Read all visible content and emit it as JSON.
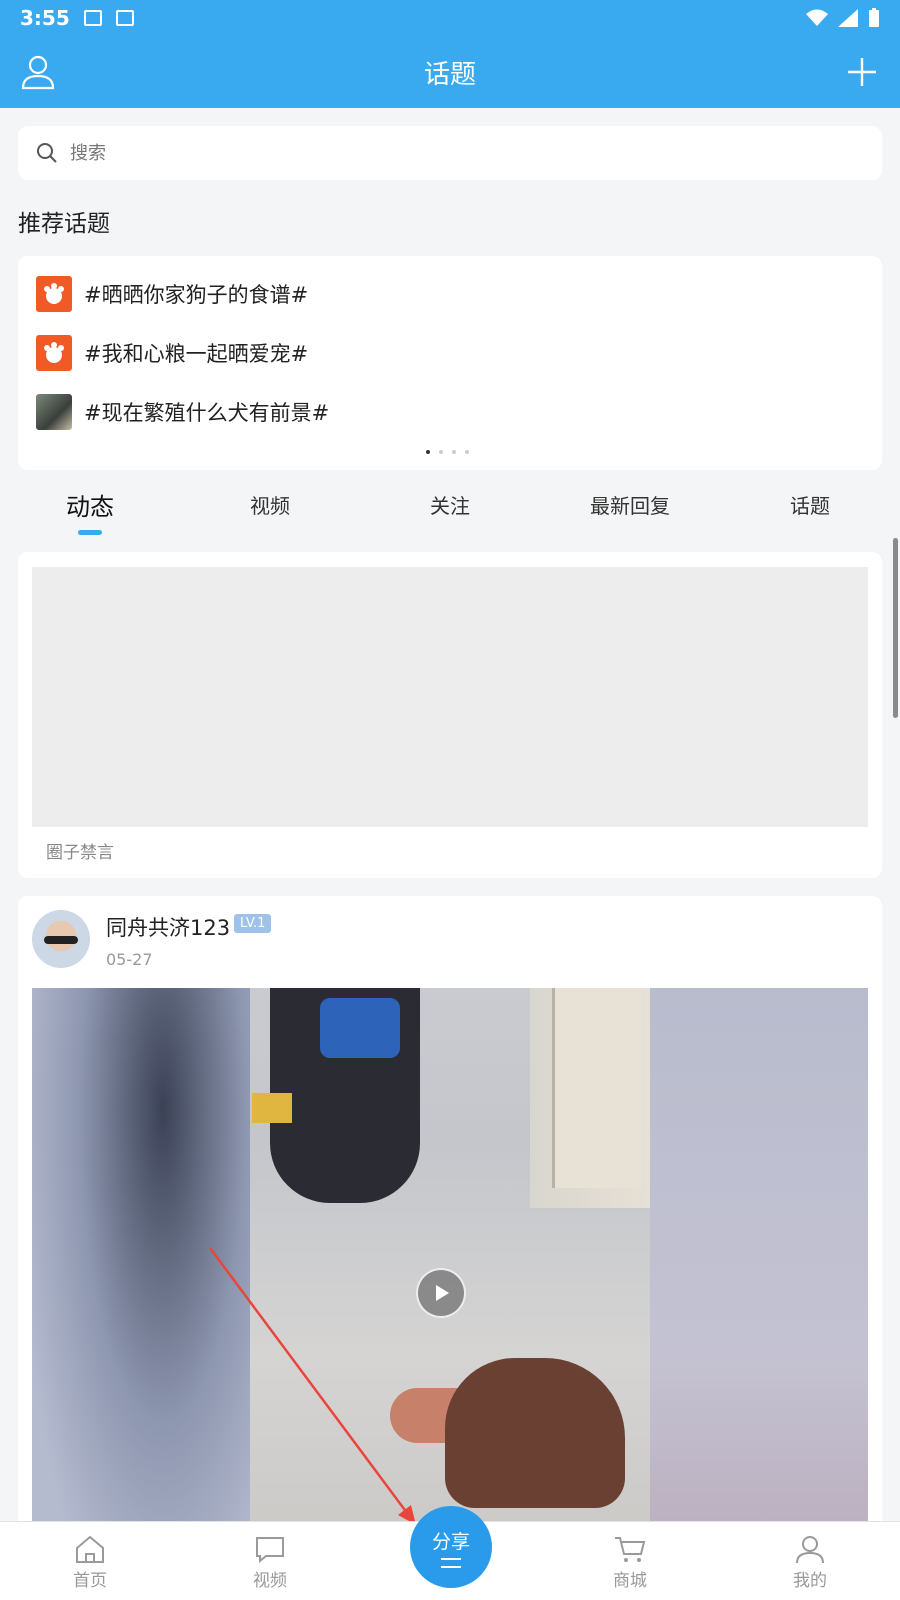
{
  "status_bar": {
    "time": "3:55"
  },
  "header": {
    "title": "话题",
    "left_icon": "user-icon",
    "right_icon": "plus-icon"
  },
  "search": {
    "placeholder": "搜索"
  },
  "recommended": {
    "title": "推荐话题",
    "topics": [
      {
        "label": "#晒晒你家狗子的食谱#",
        "icon": "brand-logo"
      },
      {
        "label": "#我和心粮一起晒爱宠#",
        "icon": "brand-logo"
      },
      {
        "label": "#现在繁殖什么犬有前景#",
        "icon": "photo-thumb"
      }
    ]
  },
  "tabs": [
    {
      "label": "动态",
      "active": true
    },
    {
      "label": "视频",
      "active": false
    },
    {
      "label": "关注",
      "active": false
    },
    {
      "label": "最新回复",
      "active": false
    },
    {
      "label": "话题",
      "active": false
    }
  ],
  "banner": {
    "caption": "圈子禁言"
  },
  "post": {
    "username": "同舟共济123",
    "level": "LV.1",
    "date": "05-27"
  },
  "bottom_nav": {
    "items": [
      {
        "label": "首页",
        "icon": "home-icon"
      },
      {
        "label": "视频",
        "icon": "video-icon"
      },
      {
        "label": "商城",
        "icon": "cart-icon"
      },
      {
        "label": "我的",
        "icon": "profile-icon"
      }
    ],
    "share_label": "分享"
  },
  "colors": {
    "accent": "#3aaaf0",
    "share": "#2a9bea",
    "annotation_arrow": "#e8453c"
  }
}
